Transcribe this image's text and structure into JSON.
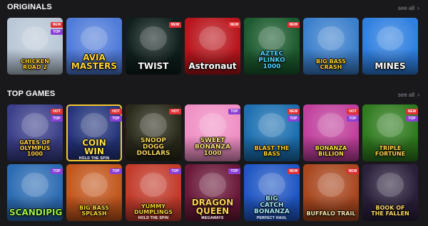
{
  "originals": {
    "title": "ORIGINALS",
    "see_all": "see all",
    "games": [
      {
        "title": "CHICKEN\nROAD 2",
        "badges": [
          "NEW",
          "TOP"
        ],
        "bg": "#b9c7d6",
        "color": "#ffcc2e"
      },
      {
        "title": "AVIA\nMASTERS",
        "badges": [],
        "bg": "#4f7bd9",
        "color": "#ffd23a"
      },
      {
        "title": "TWIST",
        "badges": [
          "NEW"
        ],
        "bg": "#0f1f1c",
        "color": "#ffffff"
      },
      {
        "title": "Astronaut",
        "badges": [
          "NEW"
        ],
        "bg": "#b8141b",
        "color": "#ffffff"
      },
      {
        "title": "AZTEC\nPLINKO\n1000",
        "badges": [
          "NEW"
        ],
        "bg": "#1b5a2e",
        "color": "#4fd7ff"
      },
      {
        "title": "BIG BASS\nCRASH",
        "badges": [],
        "bg": "#3a7fcc",
        "color": "#ffcf2b"
      },
      {
        "title": "MINES",
        "badges": [],
        "bg": "#2e7fe0",
        "color": "#ffffff"
      }
    ]
  },
  "top_games": {
    "title": "TOP GAMES",
    "see_all": "see all",
    "row1": [
      {
        "title": "GATES OF OLYMPUS\n1000",
        "badges": [
          "HOT",
          "TOP"
        ],
        "bg": "#3b3f8a",
        "color": "#ffd24a"
      },
      {
        "title": "COIN\nWIN",
        "sub": "HOLD THE SPIN",
        "badges": [
          "HOT",
          "TOP"
        ],
        "bg": "#23337a",
        "color": "#ffe04a",
        "highlight": true
      },
      {
        "title": "SNOOP\nDOGG\nDOLLARS",
        "badges": [
          "HOT"
        ],
        "bg": "#2a2a1a",
        "color": "#f5d45a"
      },
      {
        "title": "SWEET\nBONANZA\n1000",
        "badges": [
          "TOP"
        ],
        "bg": "#f08fc4",
        "color": "#ffe27a"
      },
      {
        "title": "BLAST THE\nBASS",
        "badges": [
          "NEW",
          "TOP"
        ],
        "bg": "#1b6fb0",
        "color": "#ffd02a"
      },
      {
        "title": "BONANZA\nBILLION",
        "badges": [
          "HOT",
          "TOP"
        ],
        "bg": "#c03f9c",
        "color": "#ffe04a"
      },
      {
        "title": "TRIPLE\nFORTUNE",
        "badges": [
          "NEW",
          "TOP"
        ],
        "bg": "#2f7a1e",
        "color": "#ffd84a"
      }
    ],
    "row2": [
      {
        "title": "SCANDIPIGS",
        "badges": [
          "TOP"
        ],
        "bg": "#2b6bb3",
        "color": "#9cf04a"
      },
      {
        "title": "BIG BASS\nSPLASH",
        "badges": [
          "TOP"
        ],
        "bg": "#c2561c",
        "color": "#ffd23a"
      },
      {
        "title": "YUMMY\nDUMPLINGS",
        "sub": "HOLD THE SPIN",
        "badges": [
          "TOP"
        ],
        "bg": "#c23a2a",
        "color": "#ffd23a"
      },
      {
        "title": "DRAGON\nQUEEN",
        "sub": "MEGAWAYS",
        "badges": [
          "TOP"
        ],
        "bg": "#6a1838",
        "color": "#ffcf55"
      },
      {
        "title": "BIG\nCATCH\nBONANZA",
        "sub": "PERFECT HAUL",
        "badges": [
          "NEW"
        ],
        "bg": "#1f56c4",
        "color": "#9fe8ff"
      },
      {
        "title": "BUFFALO TRAIL",
        "badges": [
          "NEW"
        ],
        "bg": "#a8461e",
        "color": "#ffe6a8"
      },
      {
        "title": "BOOK OF\nTHE FALLEN",
        "badges": [],
        "bg": "#2a1f3a",
        "color": "#ffd86a"
      }
    ]
  }
}
